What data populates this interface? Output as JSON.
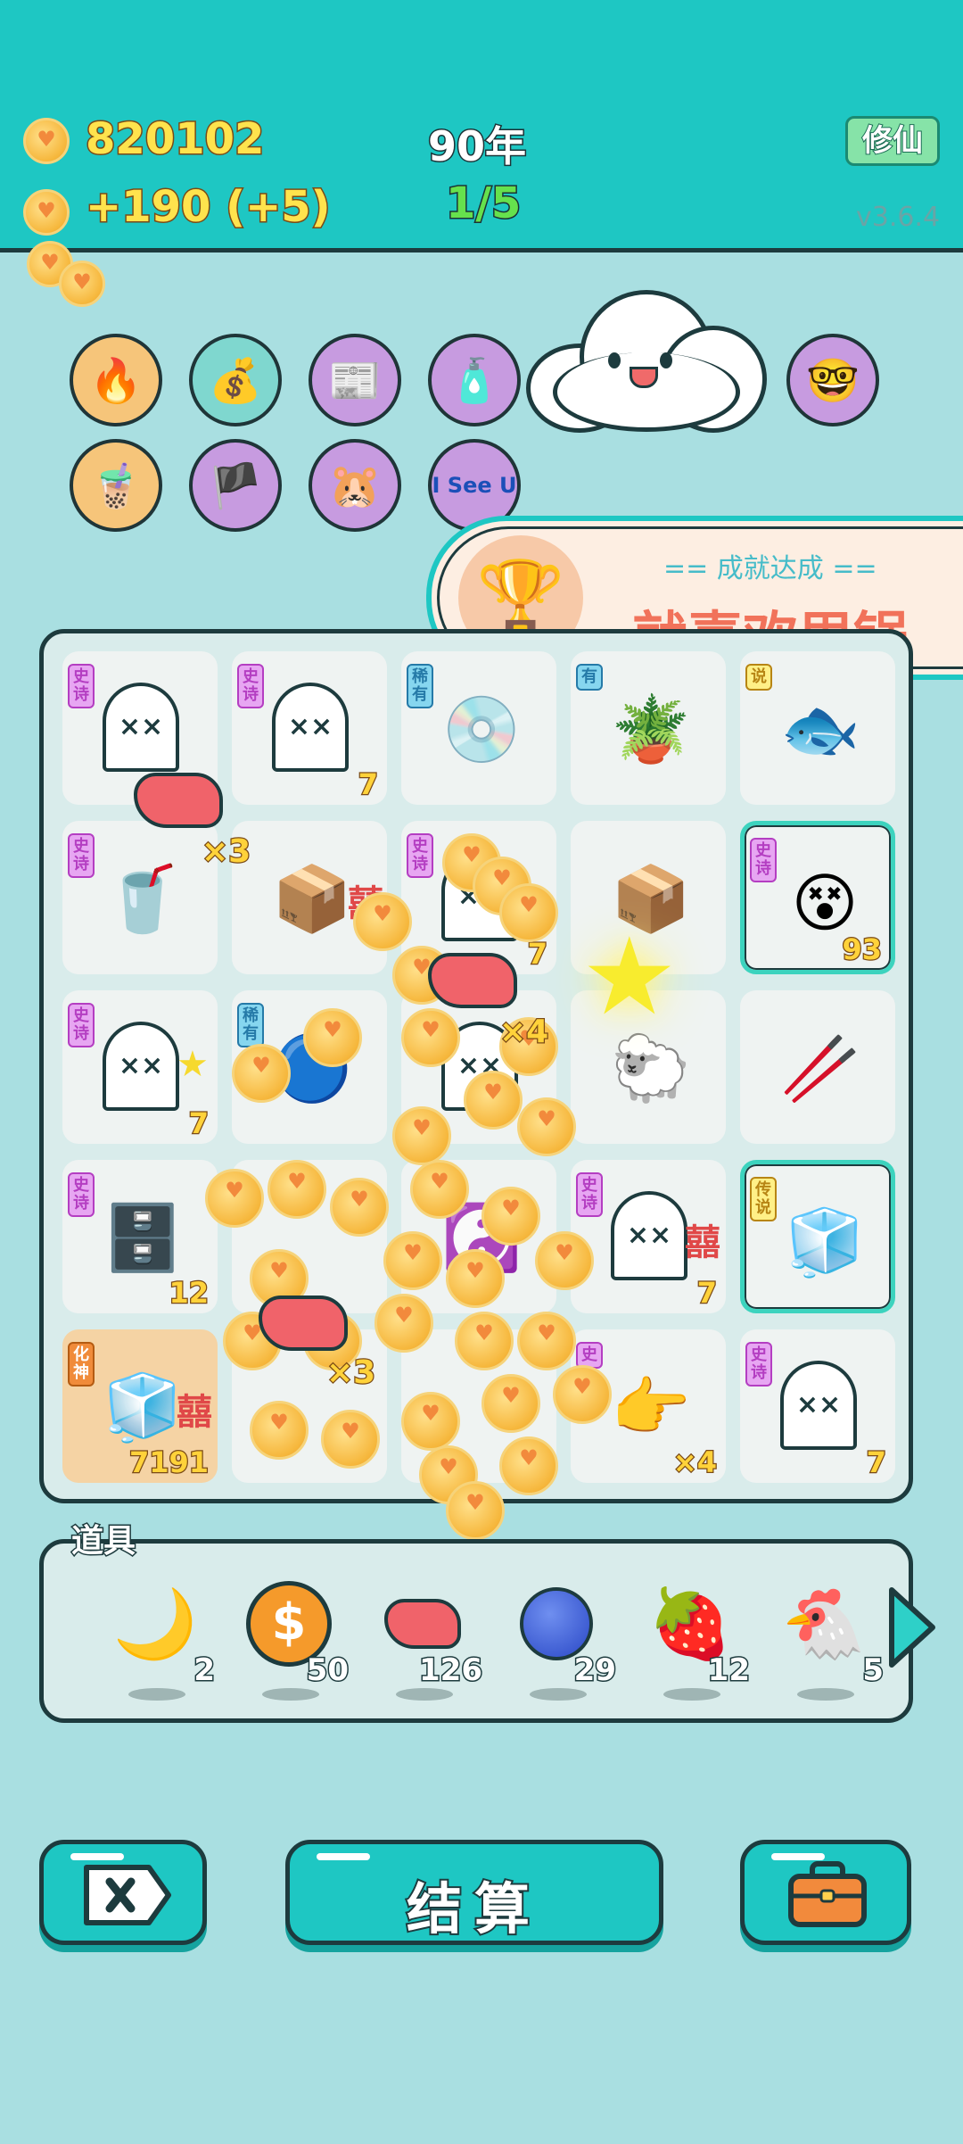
{
  "header": {
    "coins": "820102",
    "income": "+190 (+5)",
    "year": "90年",
    "progress": "1/5",
    "cultivate_label": "修仙",
    "version": "v3.6.4"
  },
  "relics": [
    {
      "icon": "heart-flame-icon",
      "glyph": "🔥"
    },
    {
      "icon": "seed-bag-icon",
      "glyph": "💰"
    },
    {
      "icon": "time-magazine-icon",
      "glyph": "📰"
    },
    {
      "icon": "spray-bottle-icon",
      "glyph": "🧴"
    },
    {
      "icon": "nerd-face-icon",
      "glyph": "🤓"
    },
    {
      "icon": "bubble-tea-icon",
      "glyph": "🧋"
    },
    {
      "icon": "eyepatch-icon",
      "glyph": "🏴"
    },
    {
      "icon": "meerkats-icon",
      "glyph": "🐹"
    },
    {
      "icon": "i-see-u-icon",
      "text": "I See U"
    }
  ],
  "achievement": {
    "title": "== 成就达成 ==",
    "name": "就喜欢甩锅"
  },
  "board": {
    "cells": [
      {
        "tag": "史诗",
        "tag_type": "epic",
        "item": "ghost",
        "count": ""
      },
      {
        "tag": "史诗",
        "tag_type": "epic",
        "item": "ghost",
        "count": "7"
      },
      {
        "tag": "稀有",
        "tag_type": "rare",
        "item": "disc",
        "glyph": "💿",
        "count": ""
      },
      {
        "tag": "有",
        "tag_type": "rare",
        "item": "wood-pot",
        "glyph": "🪴",
        "count": ""
      },
      {
        "tag": "说",
        "tag_type": "legend",
        "item": "koi",
        "glyph": "🐟",
        "count": ""
      },
      {
        "tag": "史诗",
        "tag_type": "epic",
        "item": "bubble-tea",
        "glyph": "🥤",
        "count": ""
      },
      {
        "tag": "",
        "tag_type": "",
        "item": "cardboard-box",
        "glyph": "📦",
        "count": ""
      },
      {
        "tag": "史诗",
        "tag_type": "epic",
        "item": "ghost",
        "count": "7"
      },
      {
        "tag": "",
        "tag_type": "",
        "item": "cardboard-box",
        "glyph": "📦",
        "count": ""
      },
      {
        "tag": "史诗",
        "tag_type": "epic",
        "item": "zombie-face",
        "glyph": "😵",
        "count": "93"
      },
      {
        "tag": "史诗",
        "tag_type": "epic",
        "item": "ghost",
        "count": "7"
      },
      {
        "tag": "稀有",
        "tag_type": "rare",
        "item": "blue-slime",
        "glyph": "🔵",
        "count": ""
      },
      {
        "tag": "",
        "tag_type": "",
        "item": "ghost",
        "count": ""
      },
      {
        "tag": "",
        "tag_type": "",
        "item": "sheep",
        "glyph": "🐑",
        "count": ""
      },
      {
        "tag": "",
        "tag_type": "",
        "item": "straw",
        "glyph": "🥢",
        "count": ""
      },
      {
        "tag": "史诗",
        "tag_type": "epic",
        "item": "server-rack",
        "glyph": "🗄️",
        "count": "12"
      },
      {
        "tag": "",
        "tag_type": "",
        "item": "coin-pile",
        "glyph": "",
        "count": ""
      },
      {
        "tag": "",
        "tag_type": "",
        "item": "bagua",
        "glyph": "☯️",
        "count": ""
      },
      {
        "tag": "史诗",
        "tag_type": "epic",
        "item": "ghost",
        "count": "7"
      },
      {
        "tag": "传说",
        "tag_type": "legend",
        "item": "fridge",
        "glyph": "🧊",
        "count": ""
      },
      {
        "tag": "化神",
        "tag_type": "spirit",
        "item": "fridge",
        "glyph": "🧊",
        "count": "7191"
      },
      {
        "tag": "",
        "tag_type": "",
        "item": "coin-pile",
        "glyph": "",
        "count": ""
      },
      {
        "tag": "",
        "tag_type": "",
        "item": "coin-pile",
        "glyph": "",
        "count": ""
      },
      {
        "tag": "史",
        "tag_type": "epic",
        "item": "pointing-hand",
        "glyph": "👉",
        "count": "×4"
      },
      {
        "tag": "史诗",
        "tag_type": "epic",
        "item": "ghost",
        "count": "7"
      }
    ],
    "multipliers": [
      "×3",
      "×4",
      "×3"
    ]
  },
  "tools": {
    "label": "道具",
    "items": [
      {
        "icon": "moon-icon",
        "glyph": "🌙",
        "count": "2"
      },
      {
        "icon": "dollar-coin-icon",
        "glyph": "💲",
        "count": "50"
      },
      {
        "icon": "liver-icon",
        "glyph": "",
        "count": "126"
      },
      {
        "icon": "blueberry-icon",
        "glyph": "🫐",
        "count": "29"
      },
      {
        "icon": "strawberry-icon",
        "glyph": "🍓",
        "count": "12"
      },
      {
        "icon": "chicken-icon",
        "glyph": "🐔",
        "count": "5"
      }
    ]
  },
  "footer": {
    "settle_label": "结算"
  },
  "colors": {
    "primary": "#1ec7c3",
    "background": "#a9dfe1",
    "outline": "#1d3b3e",
    "coin_text": "#ffe34d",
    "achievement_text": "#f1725a"
  }
}
